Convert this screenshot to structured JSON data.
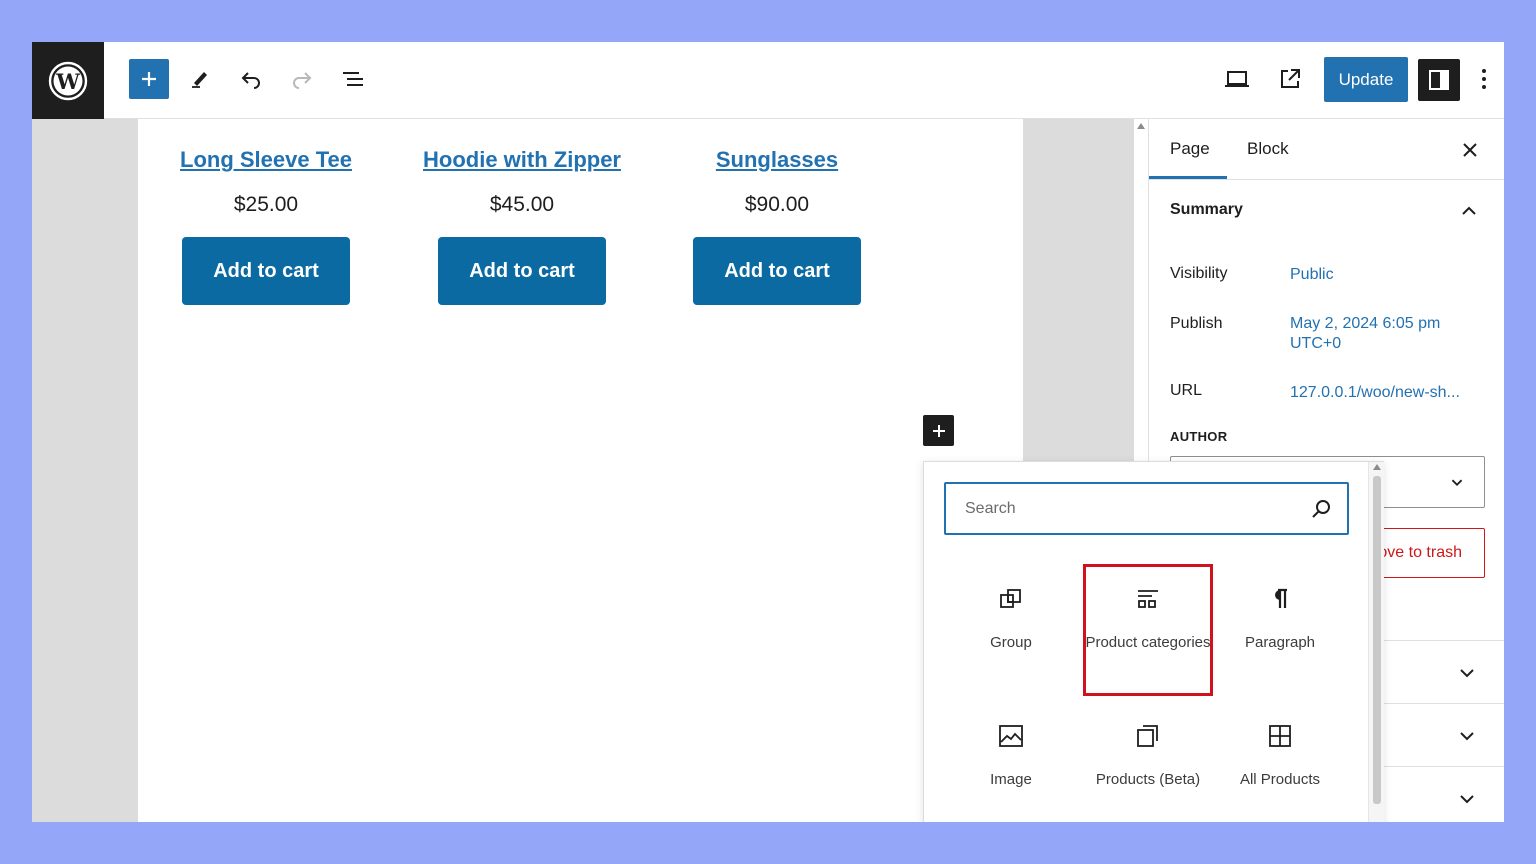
{
  "toolbar": {
    "update_label": "Update",
    "icons": [
      "wordpress-logo",
      "plus-icon",
      "pencil-icon",
      "undo-icon",
      "redo-icon",
      "list-view-icon",
      "desktop-preview-icon",
      "external-link-icon",
      "sidebar-toggle-icon",
      "more-vertical-icon"
    ]
  },
  "products": [
    {
      "title": "Long Sleeve Tee",
      "price": "$25.00",
      "button": "Add to cart"
    },
    {
      "title": "Hoodie with Zipper",
      "price": "$45.00",
      "button": "Add to cart"
    },
    {
      "title": "Sunglasses",
      "price": "$90.00",
      "button": "Add to cart"
    }
  ],
  "sidebar": {
    "tabs": [
      "Page",
      "Block"
    ],
    "active_tab": "Page",
    "summary": {
      "heading": "Summary",
      "visibility_label": "Visibility",
      "visibility_value": "Public",
      "publish_label": "Publish",
      "publish_value_line1": "May 2, 2024 6:05 pm",
      "publish_value_line2": "UTC+0",
      "url_label": "URL",
      "url_value": "127.0.0.1/woo/new-sh...",
      "author_label": "AUTHOR",
      "trash_label": "ove to trash"
    }
  },
  "inserter": {
    "search_placeholder": "Search",
    "blocks": [
      {
        "label": "Group",
        "icon": "group-icon"
      },
      {
        "label": "Product categories",
        "icon": "product-categories-icon",
        "highlighted": true
      },
      {
        "label": "Paragraph",
        "icon": "paragraph-icon"
      },
      {
        "label": "Image",
        "icon": "image-icon"
      },
      {
        "label": "Products (Beta)",
        "icon": "products-beta-icon"
      },
      {
        "label": "All Products",
        "icon": "all-products-icon"
      }
    ]
  },
  "colors": {
    "accent": "#2271b1",
    "button_blue": "#0a6aa1",
    "highlight_red": "#d0121f",
    "background": "#94a6f7"
  }
}
